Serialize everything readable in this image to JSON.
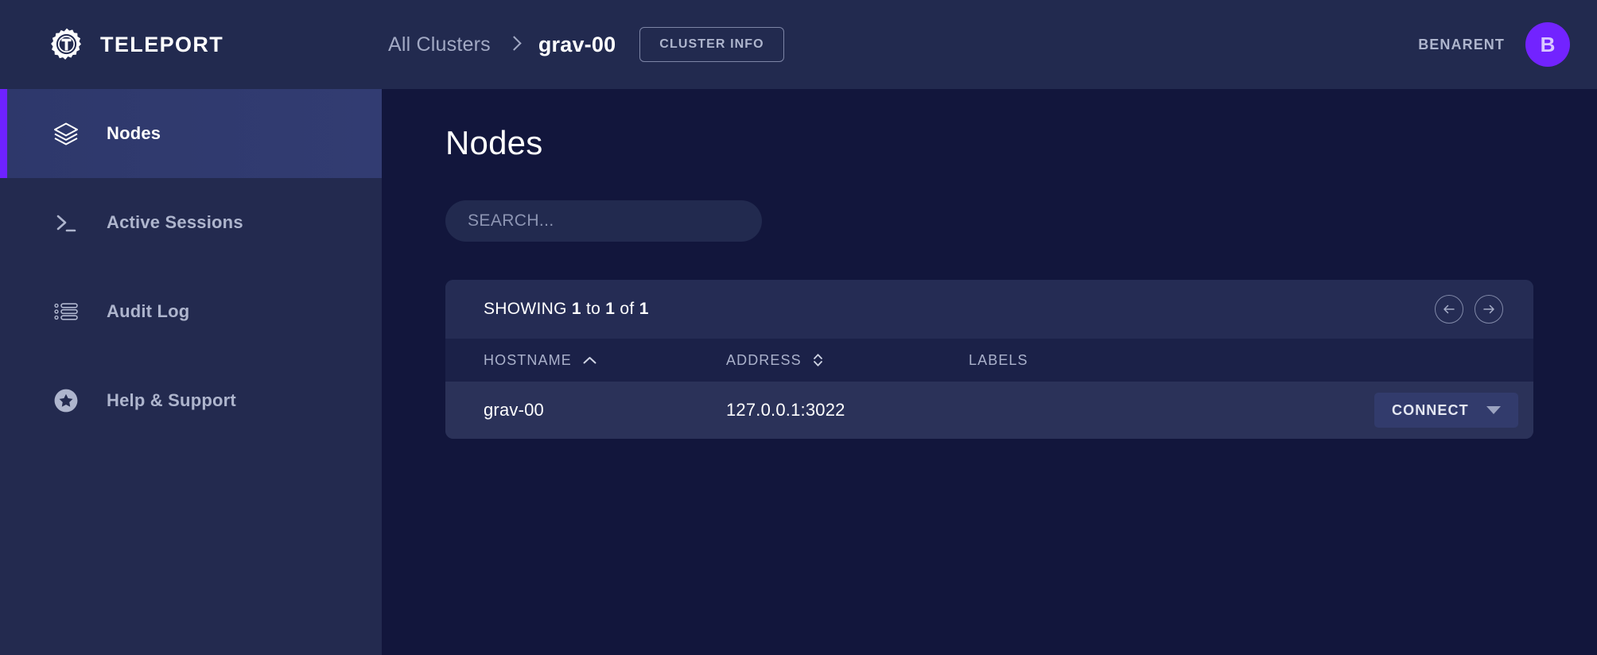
{
  "app": {
    "brand_name": "TELEPORT",
    "logo_icon": "teleport-gear-logo"
  },
  "header": {
    "breadcrumb_root": "All Clusters",
    "breadcrumb_separator_icon": "chevron-right-icon",
    "breadcrumb_current": "grav-00",
    "cluster_info_label": "CLUSTER INFO",
    "user_name": "BENARENT",
    "avatar_initial": "B",
    "avatar_color": "#7223ff"
  },
  "sidebar": {
    "items": [
      {
        "label": "Nodes",
        "icon": "layers-icon",
        "active": true
      },
      {
        "label": "Active Sessions",
        "icon": "terminal-prompt-icon",
        "active": false
      },
      {
        "label": "Audit Log",
        "icon": "bullet-list-icon",
        "active": false
      },
      {
        "label": "Help & Support",
        "icon": "star-circle-icon",
        "active": false
      }
    ],
    "active_accent_color": "#6e22ff"
  },
  "main": {
    "page_title": "Nodes",
    "search": {
      "placeholder": "SEARCH...",
      "value": "",
      "icon": "search-icon"
    },
    "panel": {
      "showing_prefix": "SHOWING",
      "showing_from": "1",
      "showing_to_word": "to",
      "showing_to": "1",
      "showing_of_word": "of",
      "showing_total": "1",
      "prev_page_icon": "arrow-left-circle-icon",
      "next_page_icon": "arrow-right-circle-icon",
      "columns": [
        {
          "label": "HOSTNAME",
          "sort_icon": "chevron-up-icon",
          "sorted": true
        },
        {
          "label": "ADDRESS",
          "sort_icon": "sort-updown-icon",
          "sorted": false
        },
        {
          "label": "LABELS",
          "sort_icon": "",
          "sorted": false
        }
      ],
      "rows": [
        {
          "hostname": "grav-00",
          "address": "127.0.0.1:3022",
          "labels": "",
          "action_label": "CONNECT",
          "action_caret_icon": "caret-down-icon"
        }
      ]
    }
  }
}
